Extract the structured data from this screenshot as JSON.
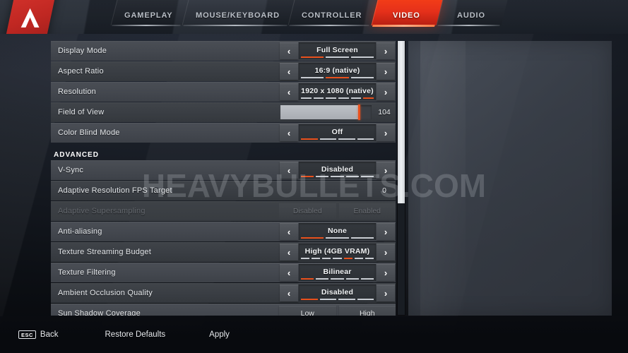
{
  "app": {
    "logo_name": "apex-legends-logo",
    "watermark": "HEAVYBULLETS.COM",
    "accent_color": "#e8501c",
    "active_tab_color": "#e5301a"
  },
  "tabs": [
    {
      "id": "gameplay",
      "label": "GAMEPLAY",
      "active": false
    },
    {
      "id": "mouse-keyboard",
      "label": "MOUSE/KEYBOARD",
      "active": false
    },
    {
      "id": "controller",
      "label": "CONTROLLER",
      "active": false
    },
    {
      "id": "video",
      "label": "VIDEO",
      "active": true
    },
    {
      "id": "audio",
      "label": "AUDIO",
      "active": false
    }
  ],
  "settings": {
    "section_advanced_label": "ADVANCED",
    "display_mode": {
      "label": "Display Mode",
      "value": "Full Screen",
      "segments": 3,
      "index": 0
    },
    "aspect_ratio": {
      "label": "Aspect Ratio",
      "value": "16:9 (native)",
      "segments": 3,
      "index": 1
    },
    "resolution": {
      "label": "Resolution",
      "value": "1920 x 1080 (native)",
      "segments": 6,
      "index": 5
    },
    "field_of_view": {
      "label": "Field of View",
      "value": "104",
      "percent": 86
    },
    "color_blind_mode": {
      "label": "Color Blind Mode",
      "value": "Off",
      "segments": 4,
      "index": 0
    },
    "v_sync": {
      "label": "V-Sync",
      "value": "Disabled",
      "segments": 5,
      "index": 0
    },
    "adaptive_res_fps": {
      "label": "Adaptive Resolution FPS Target",
      "value": "0",
      "percent": 0
    },
    "adaptive_supersampling": {
      "label": "Adaptive Supersampling",
      "disabled": true,
      "option_off": "Disabled",
      "option_on": "Enabled"
    },
    "anti_aliasing": {
      "label": "Anti-aliasing",
      "value": "None",
      "segments": 3,
      "index": 0
    },
    "texture_streaming_budget": {
      "label": "Texture Streaming Budget",
      "value": "High (4GB VRAM)",
      "segments": 7,
      "index": 4
    },
    "texture_filtering": {
      "label": "Texture Filtering",
      "value": "Bilinear",
      "segments": 5,
      "index": 0
    },
    "ambient_occlusion_quality": {
      "label": "Ambient Occlusion Quality",
      "value": "Disabled",
      "segments": 4,
      "index": 0
    },
    "sun_shadow_coverage": {
      "label": "Sun Shadow Coverage",
      "option_low": "Low",
      "option_high": "High"
    }
  },
  "controls": {
    "prev_arrow": "‹",
    "next_arrow": "›"
  },
  "footer": {
    "esc_key": "ESC",
    "back": "Back",
    "restore_defaults": "Restore Defaults",
    "apply": "Apply"
  }
}
